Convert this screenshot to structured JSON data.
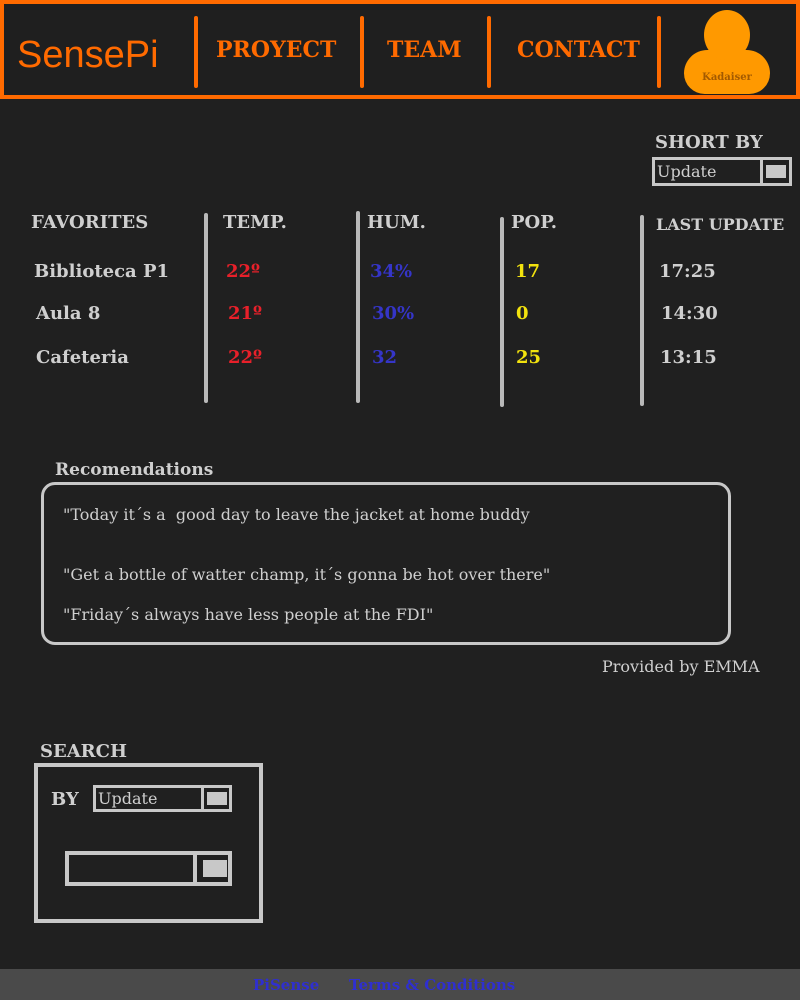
{
  "header": {
    "logo": "SensePi",
    "nav": [
      "PROYECT",
      "TEAM",
      "CONTACT"
    ],
    "user": "Kadaiser"
  },
  "sort": {
    "label": "SHORT BY",
    "value": "Update"
  },
  "table": {
    "headers": [
      "FAVORITES",
      "TEMP.",
      "HUM.",
      "POP.",
      "LAST UPDATE"
    ],
    "rows": [
      {
        "name": "Biblioteca P1",
        "temp": "22º",
        "hum": "34%",
        "pop": "17",
        "update": "17:25"
      },
      {
        "name": "Aula 8",
        "temp": "21º",
        "hum": "30%",
        "pop": "0",
        "update": "14:30"
      },
      {
        "name": "Cafeteria",
        "temp": "22º",
        "hum": "32",
        "pop": "25",
        "update": "13:15"
      }
    ]
  },
  "recommendations": {
    "title": "Recomendations",
    "items": [
      "\"Today it´s a  good day to leave the jacket at home buddy",
      "\"Get a bottle of watter champ, it´s gonna be hot over there\"",
      "\"Friday´s always have less people at the FDI\""
    ],
    "provider": "Provided by EMMA"
  },
  "search": {
    "title": "SEARCH",
    "by_label": "BY",
    "by_value": "Update",
    "query": ""
  },
  "footer": {
    "links": [
      "PiSense",
      "Terms & Conditions"
    ]
  },
  "colors": {
    "accent": "#ff6a00",
    "avatar": "#ff9900",
    "temp": "#e8202a",
    "hum": "#3535c8",
    "pop": "#f2e20e",
    "background": "#202020"
  }
}
